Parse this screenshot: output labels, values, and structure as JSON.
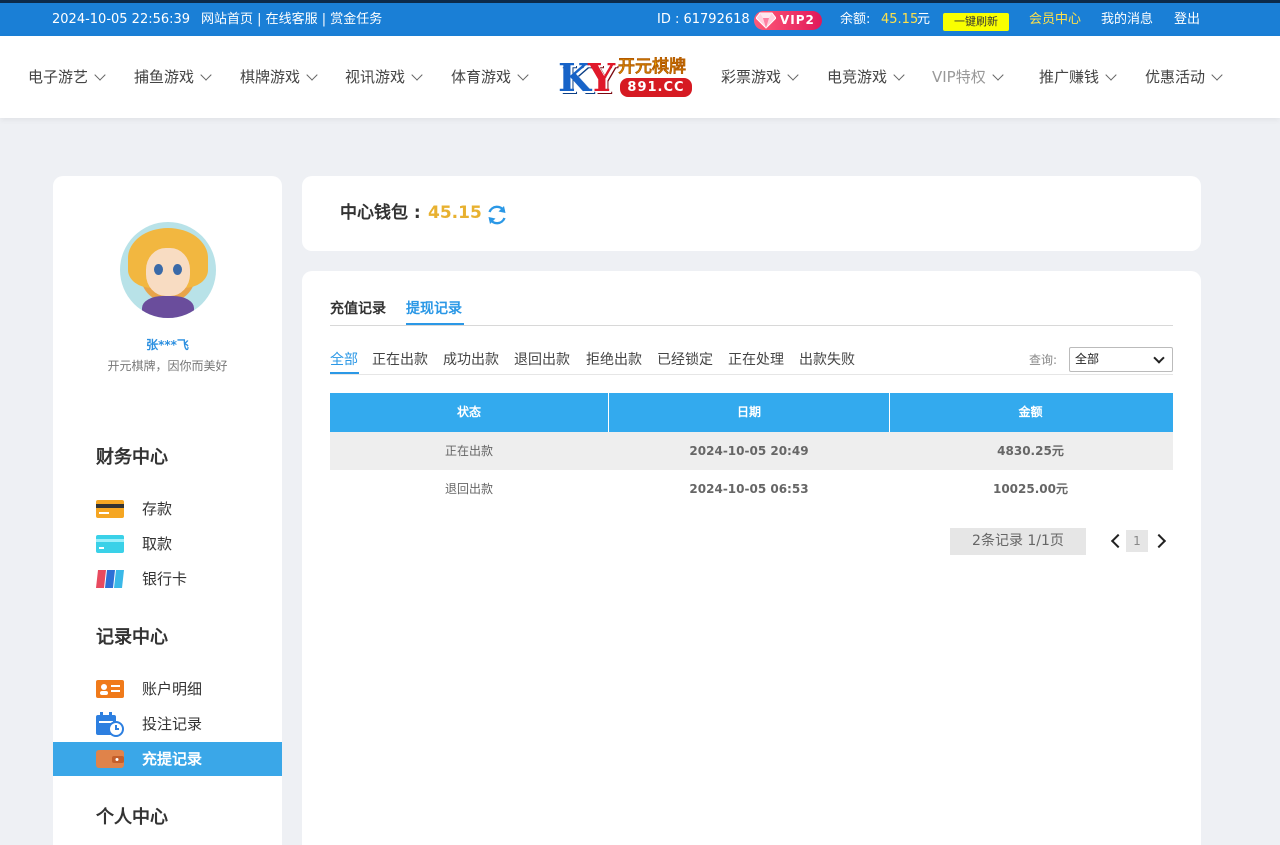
{
  "topbar": {
    "datetime": "2024-10-05 22:56:39",
    "links": "网站首页 | 在线客服 | 赏金任务",
    "user_id": "ID : 61792618",
    "vip": "VIP2",
    "balance_label": "余额:",
    "balance_value": "45.15",
    "balance_unit": "元",
    "refresh_label": "一键刷新",
    "member_center": "会员中心",
    "my_messages": "我的消息",
    "logout": "登出"
  },
  "nav": {
    "items": [
      "电子游艺",
      "捕鱼游戏",
      "棋牌游戏",
      "视讯游戏",
      "体育游戏",
      "彩票游戏",
      "电竞游戏",
      "VIP特权",
      "推广赚钱",
      "优惠活动"
    ],
    "logo_ky": "KY",
    "logo_cn": "开元棋牌",
    "logo_num": "891.CC"
  },
  "sidebar": {
    "username": "张***飞",
    "motto": "开元棋牌，因你而美好",
    "finance_title": "财务中心",
    "finance_items": [
      "存款",
      "取款",
      "银行卡"
    ],
    "records_title": "记录中心",
    "records_items": [
      "账户明细",
      "投注记录",
      "充提记录"
    ],
    "personal_title": "个人中心"
  },
  "wallet": {
    "label": "中心钱包 :",
    "amount": "45.15"
  },
  "records": {
    "tabs": [
      "充值记录",
      "提现记录"
    ],
    "active_tab": 1,
    "filters": [
      "全部",
      "正在出款",
      "成功出款",
      "退回出款",
      "拒绝出款",
      "已经锁定",
      "正在处理",
      "出款失败"
    ],
    "active_filter": 0,
    "query_label": "查询:",
    "query_value": "全部",
    "columns": [
      "状态",
      "日期",
      "金额"
    ],
    "rows": [
      {
        "status": "正在出款",
        "date": "2024-10-05 20:49",
        "amount": "4830.25元"
      },
      {
        "status": "退回出款",
        "date": "2024-10-05 06:53",
        "amount": "10025.00元"
      }
    ],
    "pager_info": "2条记录  1/1页",
    "page": "1"
  },
  "colors": {
    "topbar": "#1a7fd6",
    "accent": "#2b98e6",
    "table_header": "#33aaee",
    "sidebar_active": "#3aa7e8",
    "amount": "#e8b130"
  }
}
